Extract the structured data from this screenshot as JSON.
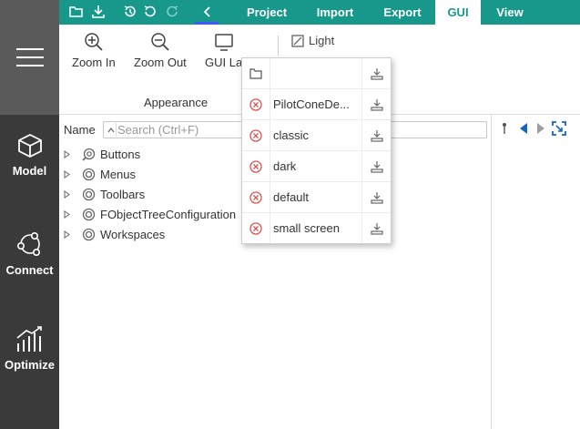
{
  "colors": {
    "accent": "#17988a",
    "sidebar_dark": "#3a3a3a",
    "sidebar_top": "#5a5a5a",
    "error_red": "#d9534f",
    "nav_blue": "#1565c0"
  },
  "sidebar": {
    "menu_icon": "hamburger-icon",
    "items": [
      {
        "label": "Model",
        "icon": "cube-icon"
      },
      {
        "label": "Connect",
        "icon": "connect-nodes-icon"
      },
      {
        "label": "Optimize",
        "icon": "trend-bars-icon"
      }
    ]
  },
  "quick_access": [
    "folder-open-icon",
    "download-icon",
    "history-icon",
    "undo-icon",
    "redo-icon",
    "back-chevron-icon"
  ],
  "tabs": [
    {
      "label": "Project",
      "active": false
    },
    {
      "label": "Import",
      "active": false
    },
    {
      "label": "Export",
      "active": false
    },
    {
      "label": "GUI",
      "active": true
    },
    {
      "label": "View",
      "active": false
    }
  ],
  "ribbon": {
    "zoom_in": "Zoom In",
    "zoom_out": "Zoom Out",
    "gui_layout": "GUI La",
    "group_label": "Appearance",
    "light": "Light"
  },
  "tree": {
    "name_label": "Name",
    "search_placeholder": "Search (Ctrl+F)",
    "items": [
      {
        "label": "Buttons",
        "icon": "search-gear-icon"
      },
      {
        "label": "Menus",
        "icon": "radio-circle-icon"
      },
      {
        "label": "Toolbars",
        "icon": "radio-circle-icon"
      },
      {
        "label": "FObjectTreeConfiguration",
        "icon": "radio-circle-icon"
      },
      {
        "label": "Workspaces",
        "icon": "radio-circle-icon"
      }
    ]
  },
  "layout_popup": {
    "rows": [
      {
        "label": "",
        "left_icon": "folder-open-icon",
        "right_icon": "download-icon"
      },
      {
        "label": "PilotConeDe...",
        "left_icon": "remove-circle-icon",
        "right_icon": "download-icon"
      },
      {
        "label": "classic",
        "left_icon": "remove-circle-icon",
        "right_icon": "download-icon"
      },
      {
        "label": "dark",
        "left_icon": "remove-circle-icon",
        "right_icon": "download-icon"
      },
      {
        "label": "default",
        "left_icon": "remove-circle-icon",
        "right_icon": "download-icon"
      },
      {
        "label": "small screen",
        "left_icon": "remove-circle-icon",
        "right_icon": "download-icon"
      }
    ]
  },
  "right_panel": {
    "icons": [
      "pin-icon",
      "nav-left-icon",
      "nav-right-icon",
      "fit-view-icon"
    ]
  }
}
